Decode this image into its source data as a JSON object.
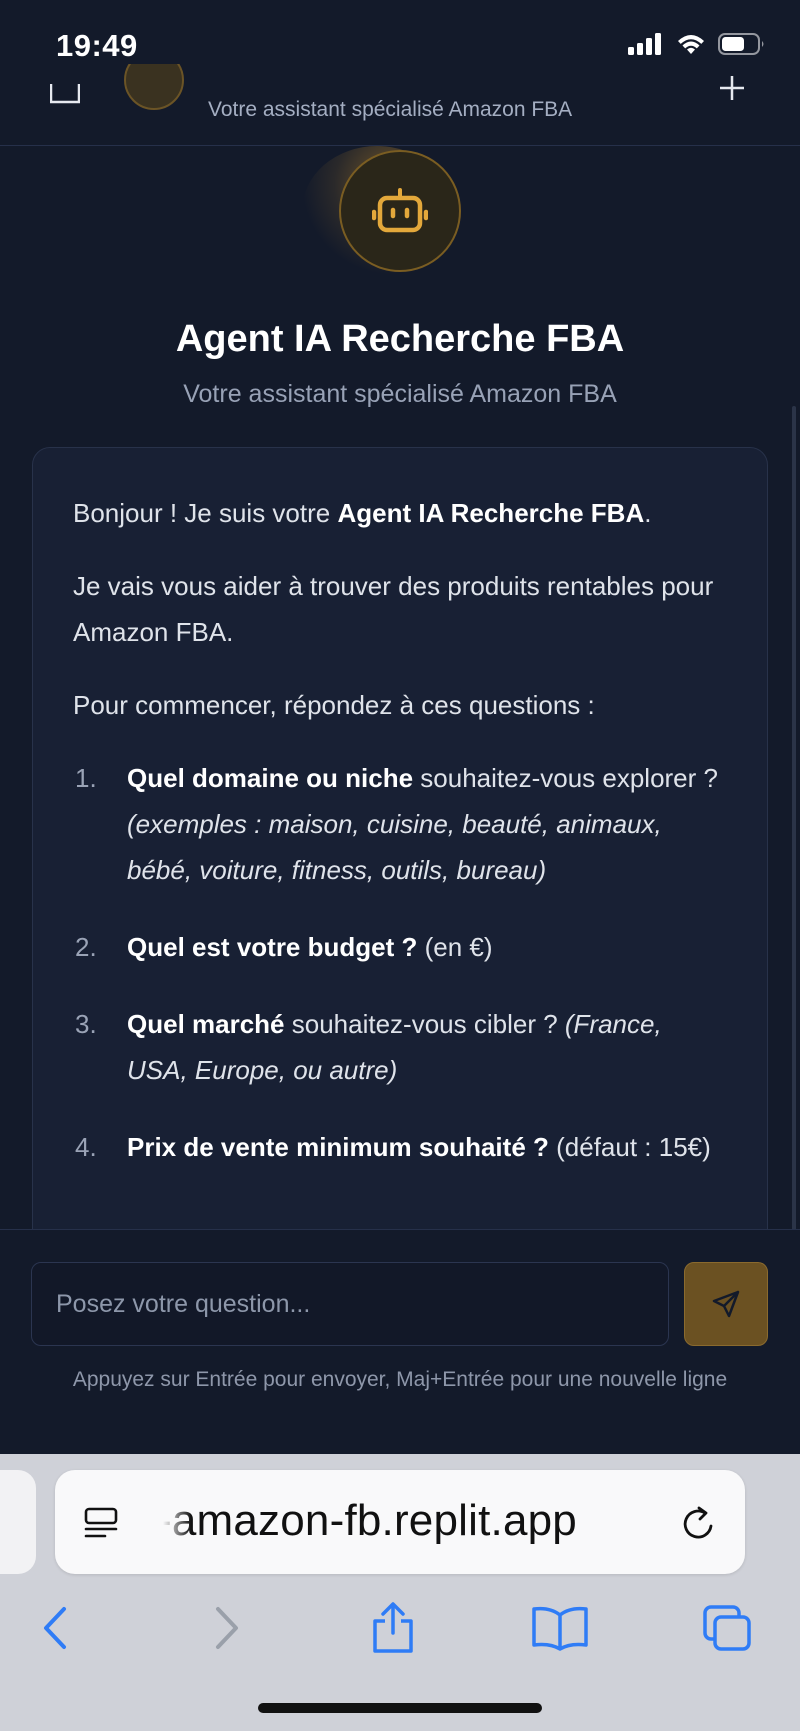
{
  "status": {
    "time": "19:49"
  },
  "header": {
    "subtitle": "Votre assistant spécialisé Amazon FBA"
  },
  "hero": {
    "title": "Agent IA Recherche FBA",
    "subtitle": "Votre assistant spécialisé Amazon FBA"
  },
  "message": {
    "greet_prefix": "Bonjour ! Je suis votre ",
    "greet_bold": "Agent IA Recherche FBA",
    "greet_suffix": ".",
    "intro": "Je vais vous aider à trouver des produits rentables pour Amazon FBA.",
    "lead": "Pour commencer, répondez à ces questions :",
    "questions": [
      {
        "num": "1.",
        "bold": "Quel domaine ou niche",
        "text": " souhaitez-vous explorer ? ",
        "italic": "(exemples : maison, cuisine, beauté, animaux, bébé, voiture, fitness, outils, bureau)"
      },
      {
        "num": "2.",
        "bold": "Quel est votre budget ?",
        "text": " (en €)",
        "italic": ""
      },
      {
        "num": "3.",
        "bold": "Quel marché",
        "text": " souhaitez-vous cibler ? ",
        "italic": "(France, USA, Europe, ou autre)"
      },
      {
        "num": "4.",
        "bold": "Prix de vente minimum souhaité ?",
        "text": " (défaut : 15€)",
        "italic": ""
      }
    ]
  },
  "composer": {
    "placeholder": "Posez votre question...",
    "hint": "Appuyez sur Entrée pour envoyer, Maj+Entrée pour une nouvelle ligne"
  },
  "browser": {
    "url": "-amazon-fb.replit.app"
  },
  "colors": {
    "accent": "#d9a233",
    "background": "#131a2a",
    "bubble": "#182034"
  },
  "icons": [
    "signal-icon",
    "wifi-icon",
    "battery-icon",
    "sidebar-toggle-icon",
    "bot-icon",
    "plus-icon",
    "send-icon",
    "reader-icon",
    "reload-icon",
    "back-icon",
    "forward-icon",
    "share-icon",
    "bookmarks-icon",
    "tabs-icon"
  ]
}
